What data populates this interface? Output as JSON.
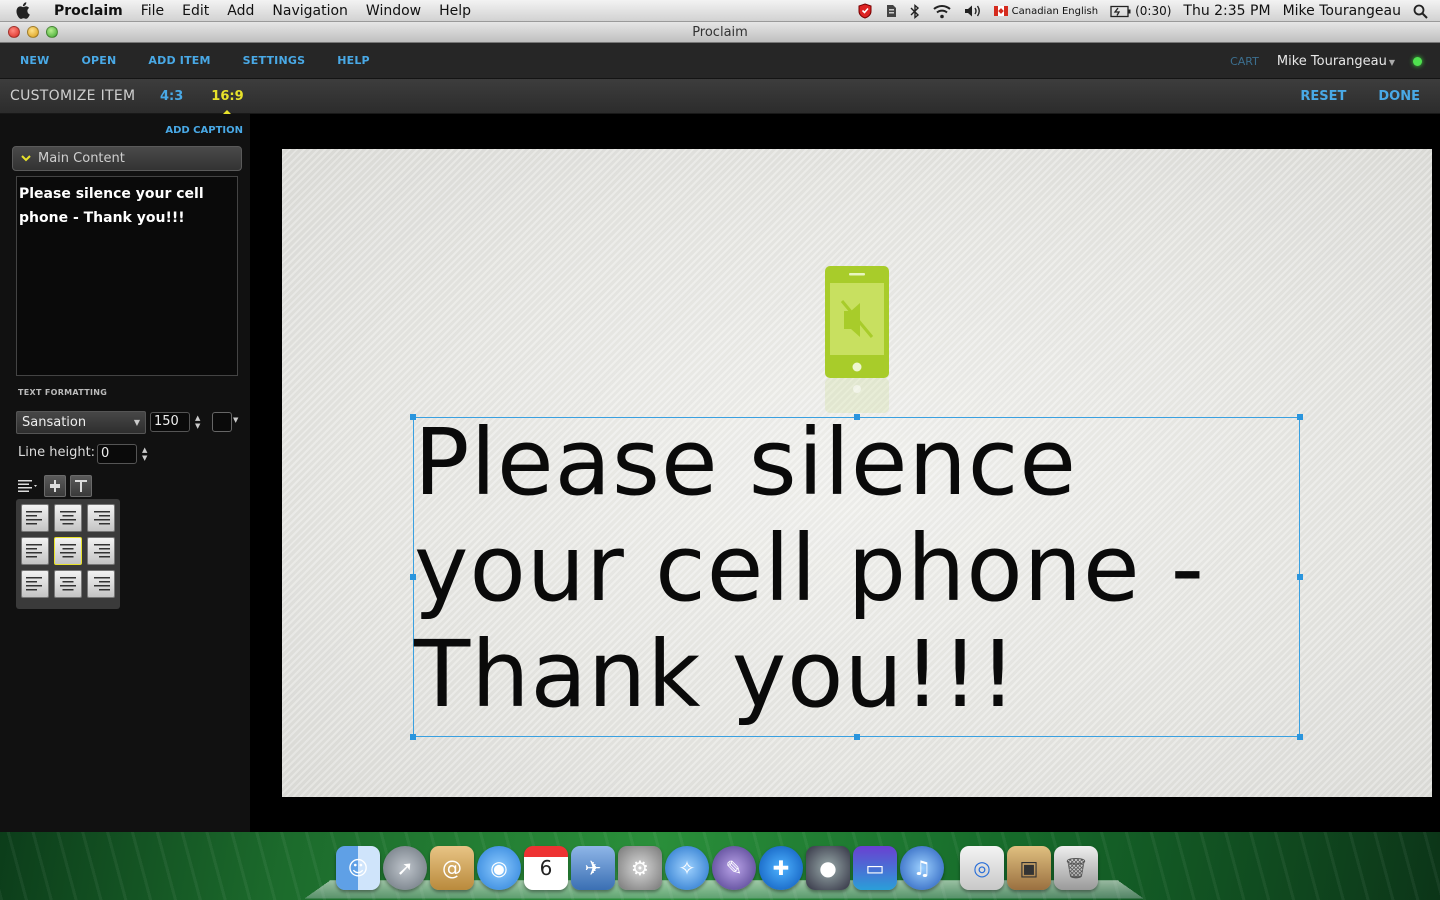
{
  "menubar": {
    "app_name": "Proclaim",
    "menus": [
      "File",
      "Edit",
      "Add",
      "Navigation",
      "Window",
      "Help"
    ],
    "input_language": "Canadian English",
    "battery_time": "(0:30)",
    "clock": "Thu 2:35 PM",
    "user_name": "Mike Tourangeau"
  },
  "window": {
    "title": "Proclaim"
  },
  "toolbar": {
    "nav": [
      "NEW",
      "OPEN",
      "ADD ITEM",
      "SETTINGS",
      "HELP"
    ],
    "cart_label": "CART",
    "user_label": "Mike Tourangeau",
    "status_color": "#4fe24f"
  },
  "customize": {
    "heading": "CUSTOMIZE ITEM",
    "ratio_4_3": "4:3",
    "ratio_16_9": "16:9",
    "active_ratio": "16:9",
    "reset_label": "RESET",
    "done_label": "DONE"
  },
  "panel": {
    "add_caption_label": "ADD CAPTION",
    "section_title": "Main Content",
    "content_text": "Please silence your cell phone - Thank you!!!",
    "text_formatting_label": "TEXT FORMATTING",
    "font_family": "Sansation",
    "font_size": "150",
    "line_height_label": "Line height:",
    "line_height_value": "0",
    "selected_alignment": "middle-center"
  },
  "slide": {
    "caption_text": "Please silence your cell phone - Thank you!!!",
    "icon": "muted-phone-icon",
    "icon_color": "#a8cc2a"
  },
  "dock": {
    "icons": [
      "finder-icon",
      "launchpad-icon",
      "address-book-icon",
      "facetime-icon",
      "ical-icon",
      "preview-icon",
      "system-preferences-icon",
      "safari-icon",
      "script-editor-icon",
      "proclaim-icon",
      "photo-booth-icon",
      "display-icon",
      "itunes-icon",
      "downloads-stack-icon",
      "documents-stack-icon",
      "trash-icon"
    ]
  },
  "colors": {
    "accent_blue": "#49a9e6",
    "accent_yellow": "#e8e22a",
    "selection_blue": "#3aa0e0"
  }
}
